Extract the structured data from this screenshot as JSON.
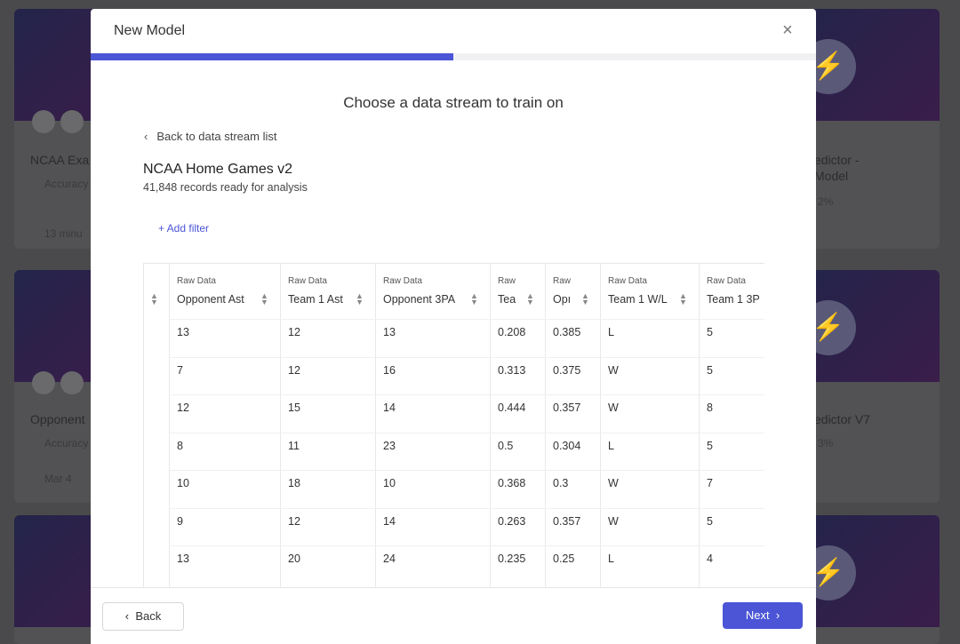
{
  "background": {
    "left_cards": [
      {
        "title": "NCAA Exa",
        "metric": "Accuracy",
        "time": "13 minu"
      },
      {
        "title": "Opponent",
        "metric": "Accuracy",
        "time": "Mar 4"
      }
    ],
    "right_cards": [
      {
        "title": "edictor -",
        "title2": "Model",
        "metric": "2%"
      },
      {
        "title": "edictor V7",
        "metric": "3%"
      }
    ]
  },
  "modal": {
    "title": "New Model",
    "close_label": "×",
    "progress_percent": 50,
    "heading": "Choose a data stream to train on",
    "back_link": "Back to data stream list",
    "stream_name": "NCAA Home Games v2",
    "stream_records": "41,848 records ready for analysis",
    "add_filter": "+ Add filter"
  },
  "table": {
    "columns": [
      {
        "group": "Raw Data",
        "name": "Opponent Ast"
      },
      {
        "group": "Raw Data",
        "name": "Team 1 Ast"
      },
      {
        "group": "Raw Data",
        "name": "Opponent 3PA"
      },
      {
        "group": "Raw",
        "name": "Tea"
      },
      {
        "group": "Raw",
        "name": "Opı"
      },
      {
        "group": "Raw Data",
        "name": "Team 1 W/L"
      },
      {
        "group": "Raw Data",
        "name": "Team 1 3P"
      }
    ],
    "rows": [
      [
        "13",
        "12",
        "13",
        "0.208",
        "0.385",
        "L",
        "5"
      ],
      [
        "7",
        "12",
        "16",
        "0.313",
        "0.375",
        "W",
        "5"
      ],
      [
        "12",
        "15",
        "14",
        "0.444",
        "0.357",
        "W",
        "8"
      ],
      [
        "8",
        "11",
        "23",
        "0.5",
        "0.304",
        "L",
        "5"
      ],
      [
        "10",
        "18",
        "10",
        "0.368",
        "0.3",
        "W",
        "7"
      ],
      [
        "9",
        "12",
        "14",
        "0.263",
        "0.357",
        "W",
        "5"
      ],
      [
        "13",
        "20",
        "24",
        "0.235",
        "0.25",
        "L",
        "4"
      ]
    ]
  },
  "footer": {
    "back_label": "Back",
    "next_label": "Next"
  },
  "colors": {
    "accent": "#4b55d6"
  }
}
